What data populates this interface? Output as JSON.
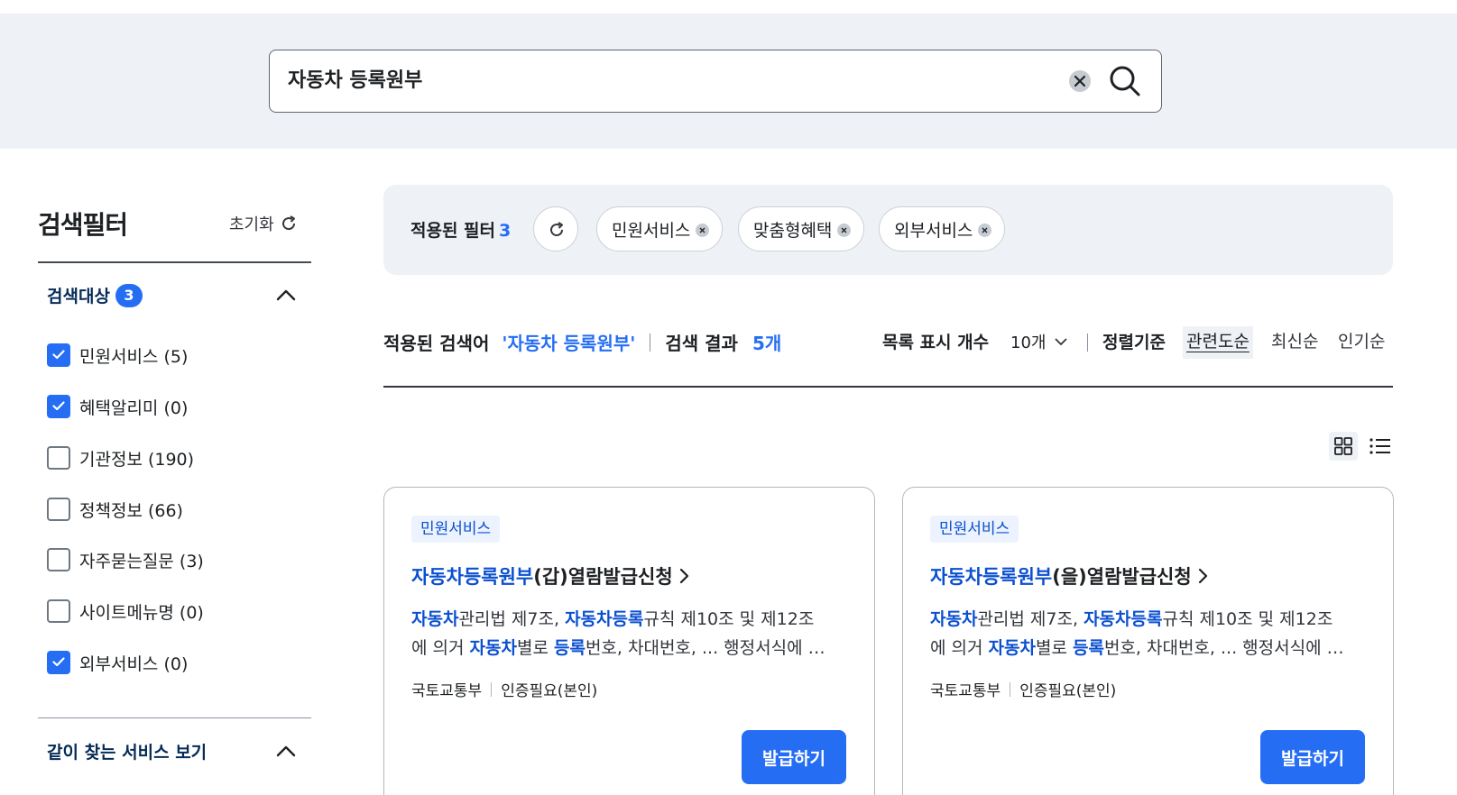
{
  "search": {
    "query": "자동차 등록원부"
  },
  "sidebar": {
    "title": "검색필터",
    "reset_label": "초기화",
    "target_section": {
      "label": "검색대상",
      "count": "3",
      "options": [
        {
          "label": "민원서비스 (5)",
          "checked": true
        },
        {
          "label": "혜택알리미 (0)",
          "checked": true
        },
        {
          "label": "기관정보 (190)",
          "checked": false
        },
        {
          "label": "정책정보 (66)",
          "checked": false
        },
        {
          "label": "자주묻는질문 (3)",
          "checked": false
        },
        {
          "label": "사이트메뉴명 (0)",
          "checked": false
        },
        {
          "label": "외부서비스 (0)",
          "checked": true
        }
      ]
    },
    "related_section": {
      "label": "같이 찾는 서비스 보기"
    }
  },
  "applied_filters": {
    "label": "적용된 필터",
    "count": "3",
    "chips": [
      "민원서비스",
      "맞춤형혜택",
      "외부서비스"
    ]
  },
  "results": {
    "keyword_label": "적용된 검색어",
    "keyword": "'자동차 등록원부'",
    "result_label": "검색 결과",
    "result_count": "5개",
    "per_page_label": "목록 표시 개수",
    "per_page_value": "10개",
    "sort_label": "정렬기준",
    "sort_options": [
      "관련도순",
      "최신순",
      "인기순"
    ],
    "active_sort": "관련도순"
  },
  "cards": [
    {
      "tag": "민원서비스",
      "title_highlight": "자동차등록원부",
      "title_rest": "(갑)열람발급신청",
      "desc_line1": [
        "자동차",
        "관리법 제7조, ",
        "자동차등록",
        "규칙 제10조 및 제12조"
      ],
      "desc_line2": [
        "에 의거 ",
        "자동차",
        "별로 ",
        "등록",
        "번호, 차대번호, ... 행정서식에 …"
      ],
      "agency": "국토교통부",
      "auth": "인증필요(본인)",
      "button": "발급하기"
    },
    {
      "tag": "민원서비스",
      "title_highlight": "자동차등록원부",
      "title_rest": "(을)열람발급신청",
      "desc_line1": [
        "자동차",
        "관리법 제7조, ",
        "자동차등록",
        "규칙 제10조 및 제12조"
      ],
      "desc_line2": [
        "에 의거 ",
        "자동차",
        "별로 ",
        "등록",
        "번호, 차대번호, ... 행정서식에 …"
      ],
      "agency": "국토교통부",
      "auth": "인증필요(본인)",
      "button": "발급하기"
    }
  ],
  "colors": {
    "accent": "#256ef4",
    "highlight": "#0b50d0",
    "band": "#eef1f5"
  }
}
